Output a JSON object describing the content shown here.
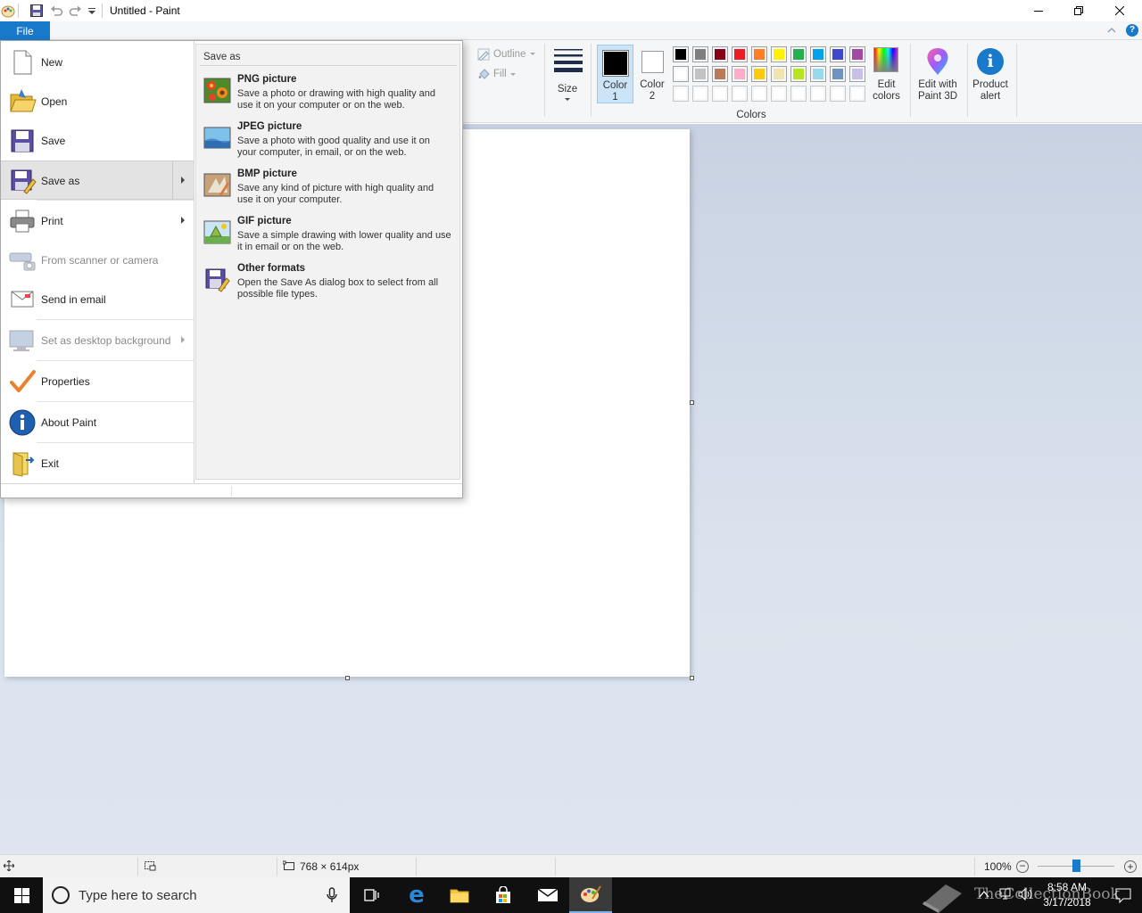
{
  "window": {
    "title": "Untitled - Paint",
    "file_tab": "File"
  },
  "ribbon": {
    "outline_label": "Outline",
    "fill_label": "Fill",
    "size_label": "Size",
    "color1_label_top": "Color",
    "color1_label_bottom": "1",
    "color2_label_top": "Color",
    "color2_label_bottom": "2",
    "colors_group_label": "Colors",
    "edit_colors_top": "Edit",
    "edit_colors_bottom": "colors",
    "paint3d_top": "Edit with",
    "paint3d_bottom": "Paint 3D",
    "product_alert_top": "Product",
    "product_alert_bottom": "alert",
    "color1_value": "#000000",
    "color2_value": "#ffffff",
    "palette_row1": [
      "#000000",
      "#7f7f7f",
      "#880015",
      "#ed1c24",
      "#ff7f27",
      "#fff200",
      "#22b14c",
      "#00a2e8",
      "#3f48cc",
      "#a349a4"
    ],
    "palette_row2": [
      "#ffffff",
      "#c3c3c3",
      "#b97a57",
      "#ffaec9",
      "#ffc90e",
      "#efe4b0",
      "#b5e61d",
      "#99d9ea",
      "#7092be",
      "#c8bfe7"
    ],
    "palette_row3": [
      "#ffffff",
      "#ffffff",
      "#ffffff",
      "#ffffff",
      "#ffffff",
      "#ffffff",
      "#ffffff",
      "#ffffff",
      "#ffffff",
      "#ffffff"
    ]
  },
  "file_menu": {
    "items": [
      {
        "label": "New",
        "icon": "new-file-icon",
        "enabled": true
      },
      {
        "label": "Open",
        "icon": "open-folder-icon",
        "enabled": true
      },
      {
        "label": "Save",
        "icon": "floppy-disk-icon",
        "enabled": true
      },
      {
        "label": "Save as",
        "icon": "save-as-icon",
        "enabled": true,
        "selected": true
      },
      {
        "label": "Print",
        "icon": "printer-icon",
        "enabled": true
      },
      {
        "label": "From scanner or camera",
        "icon": "scanner-icon",
        "enabled": false
      },
      {
        "label": "Send in email",
        "icon": "email-icon",
        "enabled": true
      },
      {
        "label": "Set as desktop background",
        "icon": "desktop-icon",
        "enabled": false
      },
      {
        "label": "Properties",
        "icon": "checkmark-icon",
        "enabled": true
      },
      {
        "label": "About Paint",
        "icon": "info-icon",
        "enabled": true
      },
      {
        "label": "Exit",
        "icon": "exit-icon",
        "enabled": true
      }
    ]
  },
  "save_as_panel": {
    "heading": "Save as",
    "formats": [
      {
        "title": "PNG picture",
        "description": "Save a photo or drawing with high quality and use it on your computer or on the web.",
        "icon": "png-picture-icon"
      },
      {
        "title": "JPEG picture",
        "description": "Save a photo with good quality and use it on your computer, in email, or on the web.",
        "icon": "jpeg-picture-icon"
      },
      {
        "title": "BMP picture",
        "description": "Save any kind of picture with high quality and use it on your computer.",
        "icon": "bmp-picture-icon"
      },
      {
        "title": "GIF picture",
        "description": "Save a simple drawing with lower quality and use it in email or on the web.",
        "icon": "gif-picture-icon"
      },
      {
        "title": "Other formats",
        "description": "Open the Save As dialog box to select from all possible file types.",
        "icon": "other-formats-icon"
      }
    ]
  },
  "status_bar": {
    "canvas_size": "768 × 614px",
    "zoom": "100%"
  },
  "taskbar": {
    "search_placeholder": "Type here to search",
    "time": "8:58 AM",
    "date": "3/17/2018",
    "watermark": "TheCollectionBook"
  }
}
